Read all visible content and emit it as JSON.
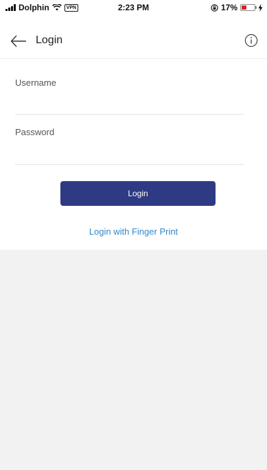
{
  "status_bar": {
    "carrier": "Dolphin",
    "vpn": "VPN",
    "time": "2:23 PM",
    "battery": "17%",
    "battery_level": 0.17
  },
  "header": {
    "title": "Login",
    "back_icon": "arrow-left-icon",
    "info_icon": "info-icon"
  },
  "form": {
    "username_label": "Username",
    "username_value": "",
    "password_label": "Password",
    "password_value": "",
    "login_label": "Login",
    "fingerprint_label": "Login with Finger Print"
  },
  "colors": {
    "primary": "#2e3a84",
    "link": "#2f88c8",
    "background": "#f2f2f2",
    "battery_low": "#e0201b"
  }
}
